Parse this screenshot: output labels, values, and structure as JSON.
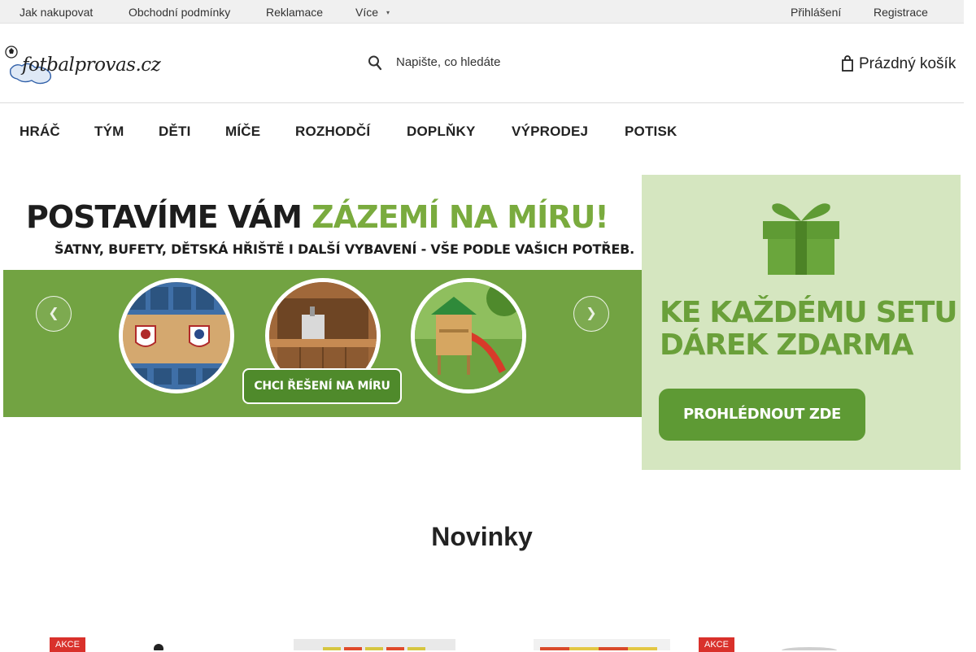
{
  "topbar": {
    "links": [
      "Jak nakupovat",
      "Obchodní podmínky",
      "Reklamace",
      "Více"
    ],
    "more_caret": "▾",
    "login": "Přihlášení",
    "register": "Registrace"
  },
  "header": {
    "logo_text": "fotbalprovas.cz",
    "search_placeholder": "Napište, co hledáte",
    "cart_label": "Prázdný košík"
  },
  "nav": {
    "items": [
      "HRÁČ",
      "TÝM",
      "DĚTI",
      "MÍČE",
      "ROZHODČÍ",
      "DOPLŇKY",
      "VÝPRODEJ",
      "POTISK"
    ]
  },
  "banner_main": {
    "title_dark": "POSTAVÍME VÁM ",
    "title_green": "ZÁZEMÍ NA MÍRU!",
    "subtitle": "ŠATNY, BUFETY, DĚTSKÁ HŘIŠTĚ I DALŠÍ VYBAVENÍ - VŠE PODLE VAŠICH POTŘEB.",
    "cta": "CHCI ŘEŠENÍ NA MÍRU",
    "prev_icon": "chevron-left-icon",
    "next_icon": "chevron-right-icon",
    "green": "#72a342"
  },
  "banner_side": {
    "line1": "KE KAŽDÉMU SETU",
    "line2": "DÁREK ZDARMA",
    "cta": "PROHLÉDNOUT ZDE",
    "bg": "#d5e6c0"
  },
  "section": {
    "title": "Novinky",
    "badges": [
      "AKCE",
      "AKCE"
    ]
  }
}
